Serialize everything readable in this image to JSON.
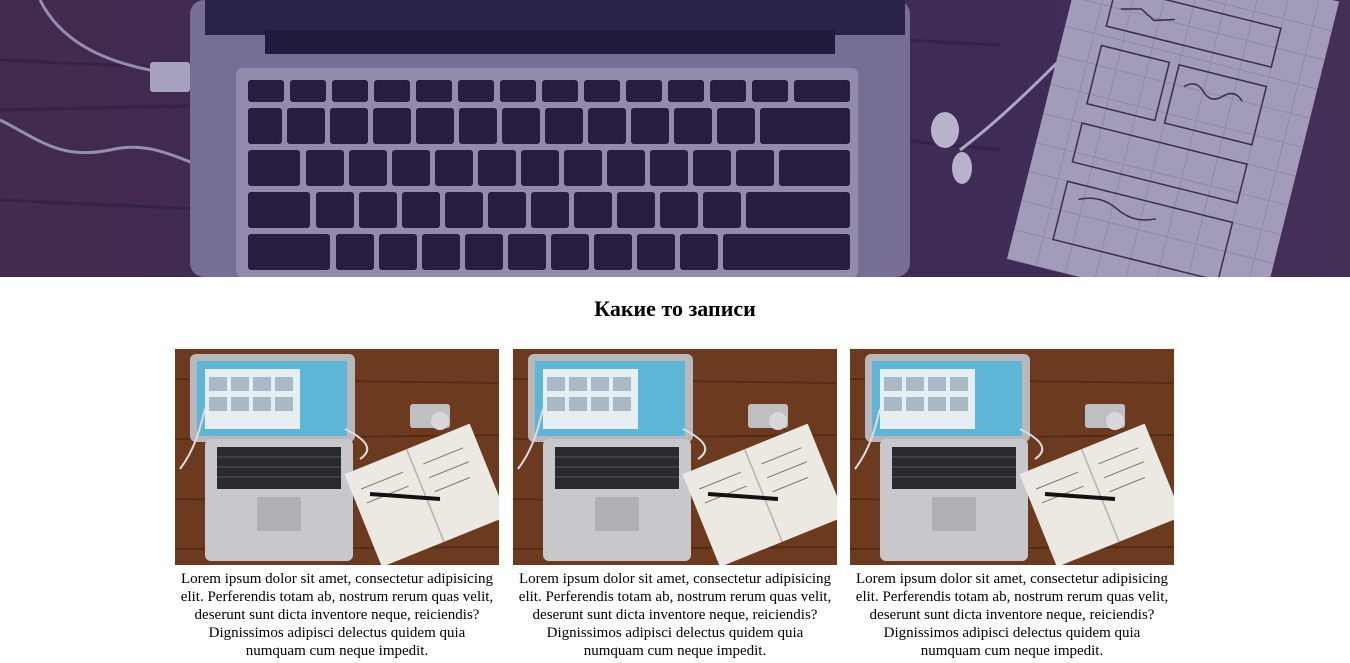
{
  "hero": {
    "image": "laptop-and-notebook-on-desk-photo"
  },
  "section": {
    "title": "Какие то записи"
  },
  "cards": [
    {
      "image": "laptop-camera-notebook-on-wooden-desk-photo",
      "text": "Lorem ipsum dolor sit amet, consectetur adipisicing elit. Perferendis totam ab, nostrum rerum quas velit, deserunt sunt dicta inventore neque, reiciendis? Dignissimos adipisci delectus quidem quia numquam cum neque impedit."
    },
    {
      "image": "laptop-camera-notebook-on-wooden-desk-photo",
      "text": "Lorem ipsum dolor sit amet, consectetur adipisicing elit. Perferendis totam ab, nostrum rerum quas velit, deserunt sunt dicta inventore neque, reiciendis? Dignissimos adipisci delectus quidem quia numquam cum neque impedit."
    },
    {
      "image": "laptop-camera-notebook-on-wooden-desk-photo",
      "text": "Lorem ipsum dolor sit amet, consectetur adipisicing elit. Perferendis totam ab, nostrum rerum quas velit, deserunt sunt dicta inventore neque, reiciendis? Dignissimos adipisci delectus quidem quia numquam cum neque impedit."
    }
  ],
  "colors": {
    "hero_tint": "#3b2d55",
    "wood": "#6b3a1f",
    "page_background": "#ffffff"
  }
}
